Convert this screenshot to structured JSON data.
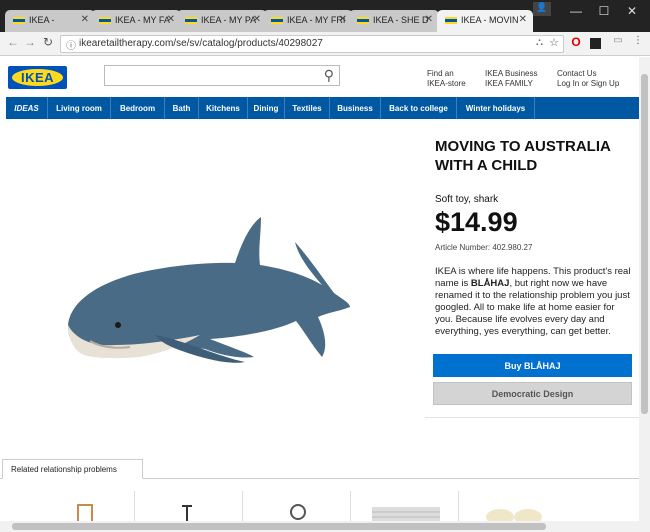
{
  "browser": {
    "tabs": [
      {
        "title": "IKEA -"
      },
      {
        "title": "IKEA - MY FA"
      },
      {
        "title": "IKEA - MY PA"
      },
      {
        "title": "IKEA - MY FRI"
      },
      {
        "title": "IKEA - SHE D"
      },
      {
        "title": "IKEA - MOVIN"
      }
    ],
    "url": "ikearetailtherapy.com/se/sv/catalog/products/40298027"
  },
  "header": {
    "logo": "IKEA",
    "find_an": "Find an",
    "ikea_store": "IKEA-store",
    "ikea_business": "IKEA Business",
    "ikea_family": "IKEA FAMILY",
    "contact_us": "Contact Us",
    "login": "Log In or Sign Up"
  },
  "nav": [
    "IDEAS",
    "Living room",
    "Bedroom",
    "Bath",
    "Kitchens",
    "Dining",
    "Textiles",
    "Business",
    "Back to college",
    "Winter holidays"
  ],
  "product": {
    "title": "MOVING TO AUSTRALIA WITH A CHILD",
    "subtitle": "Soft toy, shark",
    "price": "$14.99",
    "article": "Article Number: 402.980.27",
    "desc_1": "IKEA is where life happens. This product's real name is ",
    "desc_name": "BLÅHAJ",
    "desc_2": ", but right now we have renamed it to the relationship problem you just googled. All to make life at home easier for you. Because life evolves every day and everything, yes everything, can get better.",
    "buy_label": "Buy BLÅHAJ",
    "democratic_label": "Democratic Design"
  },
  "related": {
    "tab_label": "Related relationship problems"
  },
  "colors": {
    "ikea_blue": "#0058a3",
    "ikea_yellow": "#ffda1a",
    "buy_blue": "#0071ce"
  }
}
